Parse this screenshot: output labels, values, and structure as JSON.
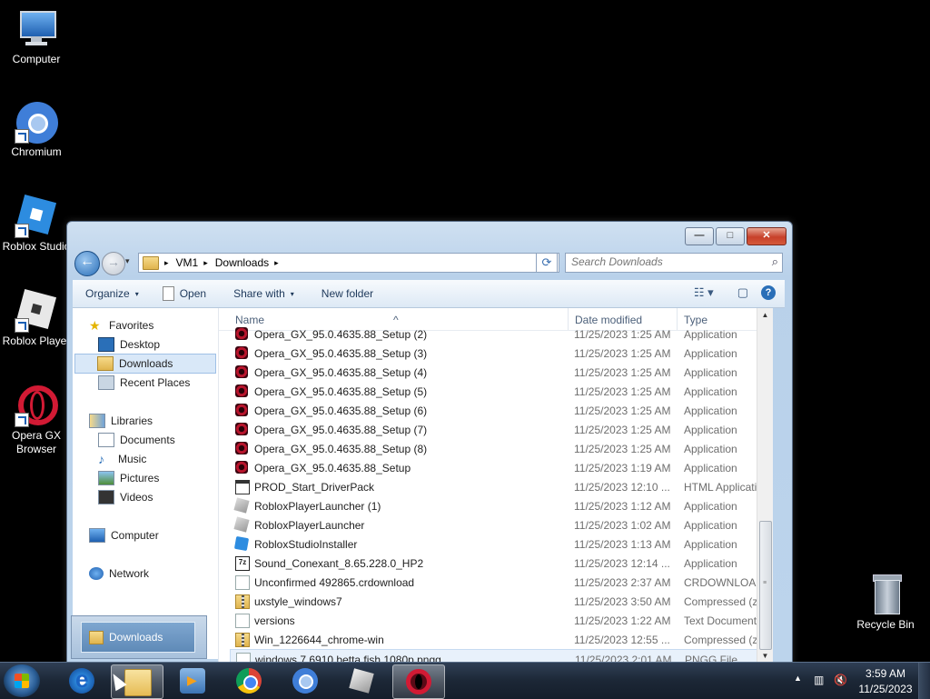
{
  "desktop": {
    "icons": [
      {
        "label": "Computer",
        "icon": "computer-icon"
      },
      {
        "label": "Chromium",
        "icon": "chromium-icon"
      },
      {
        "label": "Roblox Studio",
        "icon": "roblox-studio-icon"
      },
      {
        "label": "Roblox Player",
        "icon": "roblox-player-icon"
      },
      {
        "label": "Opera GX Browser",
        "icon": "opera-gx-icon"
      },
      {
        "label": "Recycle Bin",
        "icon": "recycle-bin-icon"
      }
    ]
  },
  "explorer": {
    "window_controls": {
      "minimize": "—",
      "maximize": "□",
      "close": "✕"
    },
    "address": {
      "crumbs": [
        "VM1",
        "Downloads"
      ],
      "sep": "▸",
      "dropdown": "▾"
    },
    "search": {
      "placeholder": "Search Downloads"
    },
    "toolbar": {
      "organize": "Organize",
      "open": "Open",
      "share_with": "Share with",
      "new_folder": "New folder",
      "caret": "▾"
    },
    "nav": {
      "favorites": "Favorites",
      "desktop": "Desktop",
      "downloads": "Downloads",
      "recent_places": "Recent Places",
      "libraries": "Libraries",
      "documents": "Documents",
      "music": "Music",
      "pictures": "Pictures",
      "videos": "Videos",
      "computer": "Computer",
      "network": "Network",
      "footer_label": "Downloads"
    },
    "columns": {
      "name": "Name",
      "date_modified": "Date modified",
      "type": "Type"
    },
    "files": [
      {
        "name": "Opera_GX_95.0.4635.88_Setup (2)",
        "date": "11/25/2023 1:25 AM",
        "type": "Application",
        "icon": "opera"
      },
      {
        "name": "Opera_GX_95.0.4635.88_Setup (3)",
        "date": "11/25/2023 1:25 AM",
        "type": "Application",
        "icon": "opera"
      },
      {
        "name": "Opera_GX_95.0.4635.88_Setup (4)",
        "date": "11/25/2023 1:25 AM",
        "type": "Application",
        "icon": "opera"
      },
      {
        "name": "Opera_GX_95.0.4635.88_Setup (5)",
        "date": "11/25/2023 1:25 AM",
        "type": "Application",
        "icon": "opera"
      },
      {
        "name": "Opera_GX_95.0.4635.88_Setup (6)",
        "date": "11/25/2023 1:25 AM",
        "type": "Application",
        "icon": "opera"
      },
      {
        "name": "Opera_GX_95.0.4635.88_Setup (7)",
        "date": "11/25/2023 1:25 AM",
        "type": "Application",
        "icon": "opera"
      },
      {
        "name": "Opera_GX_95.0.4635.88_Setup (8)",
        "date": "11/25/2023 1:25 AM",
        "type": "Application",
        "icon": "opera"
      },
      {
        "name": "Opera_GX_95.0.4635.88_Setup",
        "date": "11/25/2023 1:19 AM",
        "type": "Application",
        "icon": "opera"
      },
      {
        "name": "PROD_Start_DriverPack",
        "date": "11/25/2023 12:10 ...",
        "type": "HTML Application",
        "icon": "html"
      },
      {
        "name": "RobloxPlayerLauncher (1)",
        "date": "11/25/2023 1:12 AM",
        "type": "Application",
        "icon": "roblox"
      },
      {
        "name": "RobloxPlayerLauncher",
        "date": "11/25/2023 1:02 AM",
        "type": "Application",
        "icon": "roblox"
      },
      {
        "name": "RobloxStudioInstaller",
        "date": "11/25/2023 1:13 AM",
        "type": "Application",
        "icon": "studio"
      },
      {
        "name": "Sound_Conexant_8.65.228.0_HP2",
        "date": "11/25/2023 12:14 ...",
        "type": "Application",
        "icon": "7z"
      },
      {
        "name": "Unconfirmed 492865.crdownload",
        "date": "11/25/2023 2:37 AM",
        "type": "CRDOWNLOAD File",
        "icon": "doc"
      },
      {
        "name": "uxstyle_windows7",
        "date": "11/25/2023 3:50 AM",
        "type": "Compressed (zipped)",
        "icon": "zip"
      },
      {
        "name": "versions",
        "date": "11/25/2023 1:22 AM",
        "type": "Text Document",
        "icon": "doc"
      },
      {
        "name": "Win_1226644_chrome-win",
        "date": "11/25/2023 12:55 ...",
        "type": "Compressed (zipped)",
        "icon": "zip"
      },
      {
        "name": "windows 7 6910 betta fish 1080p.pngg",
        "date": "11/25/2023 2:01 AM",
        "type": "PNGG File",
        "icon": "doc",
        "selected": true
      }
    ]
  },
  "taskbar": {
    "apps": [
      "internet-explorer",
      "windows-explorer",
      "media-center",
      "chrome",
      "chromium",
      "roblox",
      "opera-gx"
    ],
    "clock_time": "3:59 AM",
    "clock_date": "11/25/2023"
  }
}
